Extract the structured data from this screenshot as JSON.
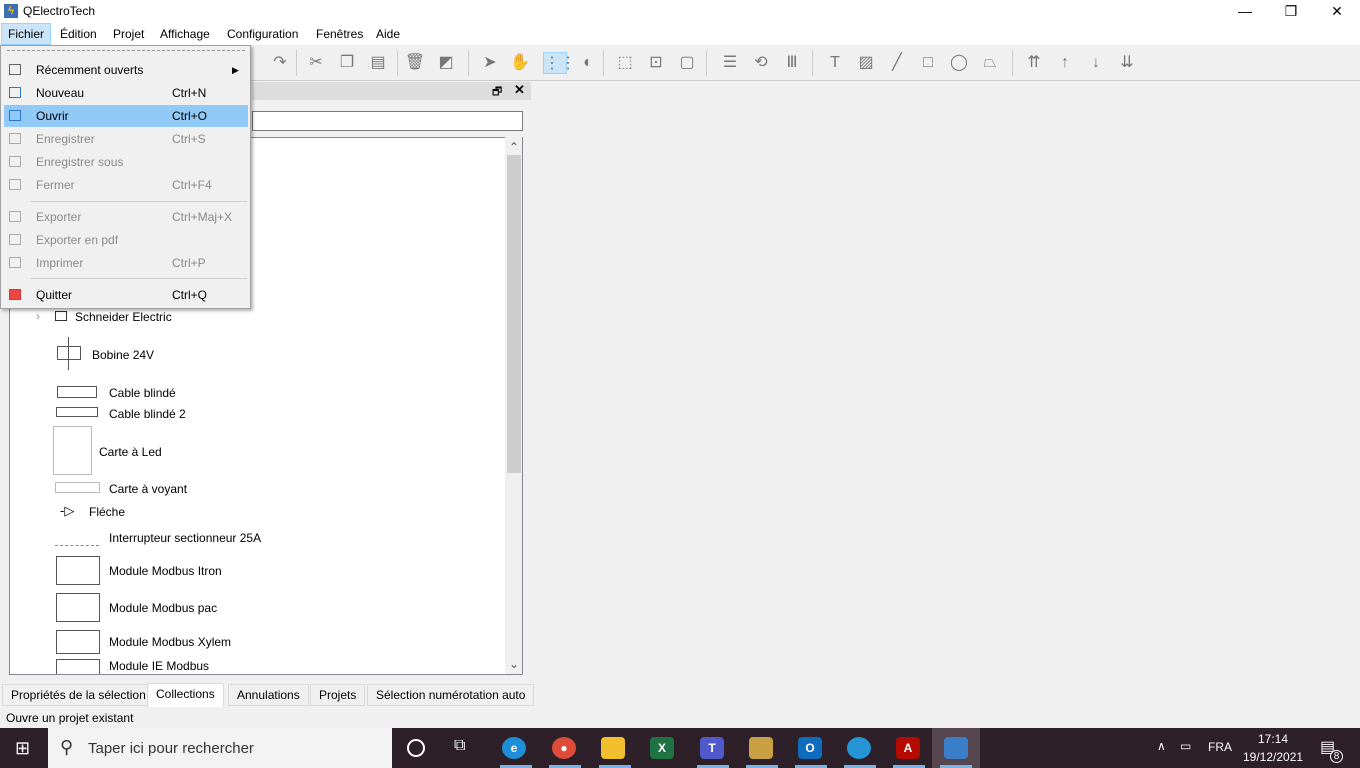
{
  "window": {
    "title": "QElectroTech",
    "controls": [
      "minimize",
      "restore",
      "close"
    ]
  },
  "menubar": [
    "Fichier",
    "Édition",
    "Projet",
    "Affichage",
    "Configuration",
    "Fenêtres",
    "Aide"
  ],
  "file_menu": {
    "items": [
      {
        "label": "Récemment ouverts",
        "shortcut": "",
        "icon": "recent-icon",
        "disabled": false,
        "submenu": true
      },
      {
        "label": "Nouveau",
        "shortcut": "Ctrl+N",
        "icon": "new-project-icon",
        "disabled": false
      },
      {
        "label": "Ouvrir",
        "shortcut": "Ctrl+O",
        "icon": "open-folder-icon",
        "disabled": false,
        "highlighted": true
      },
      {
        "label": "Enregistrer",
        "shortcut": "Ctrl+S",
        "icon": "save-icon",
        "disabled": true
      },
      {
        "label": "Enregistrer sous",
        "shortcut": "",
        "icon": "save-as-icon",
        "disabled": true
      },
      {
        "label": "Fermer",
        "shortcut": "Ctrl+F4",
        "icon": "close-project-icon",
        "disabled": true
      },
      {
        "label": "Exporter",
        "shortcut": "Ctrl+Maj+X",
        "icon": "export-icon",
        "disabled": true
      },
      {
        "label": "Exporter en pdf",
        "shortcut": "",
        "icon": "pdf-icon",
        "disabled": true
      },
      {
        "label": "Imprimer",
        "shortcut": "Ctrl+P",
        "icon": "print-icon",
        "disabled": true
      },
      {
        "label": "Quitter",
        "shortcut": "Ctrl+Q",
        "icon": "quit-icon",
        "disabled": false
      }
    ]
  },
  "collections": {
    "folder": "Schneider Electric",
    "items": [
      "Bobine 24V",
      "Cable blindé",
      "Cable blindé 2",
      "Carte à Led",
      "Carte à voyant",
      "Fléche",
      "Interrupteur sectionneur 25A",
      "Module Modbus Itron",
      "Module Modbus pac",
      "Module Modbus Xylem",
      "Module IE Modbus"
    ]
  },
  "tabs": [
    "Propriétés de la sélection",
    "Collections",
    "Annulations",
    "Projets",
    "Sélection numérotation auto"
  ],
  "active_tab": "Collections",
  "status": "Ouvre un projet existant",
  "taskbar": {
    "search_placeholder": "Taper ici pour rechercher",
    "lang": "FRA",
    "time": "17:14",
    "date": "19/12/2021",
    "notifications": "8"
  },
  "colors": {
    "highlight": "#91c9f7",
    "taskbar": "#2e2029"
  }
}
